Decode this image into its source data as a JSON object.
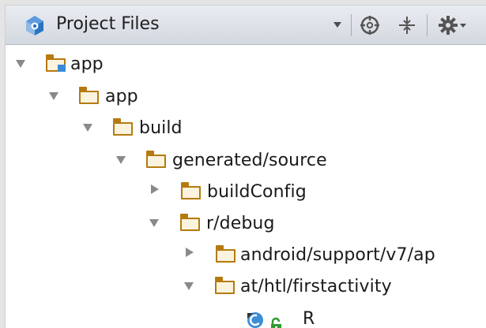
{
  "panel": {
    "view_title": "Project Files",
    "toolbar_icons": [
      "project-logo-icon",
      "chevron-down-icon",
      "scroll-from-source-icon",
      "collapse-all-icon",
      "gear-icon",
      "chevron-down-icon"
    ]
  },
  "tree": [
    {
      "label": "app",
      "kind": "module-folder",
      "state": "expanded"
    },
    {
      "label": "app",
      "kind": "folder",
      "state": "expanded"
    },
    {
      "label": "build",
      "kind": "folder",
      "state": "expanded"
    },
    {
      "label": "generated/source",
      "kind": "folder",
      "state": "expanded"
    },
    {
      "label": "buildConfig",
      "kind": "folder",
      "state": "collapsed"
    },
    {
      "label": "r/debug",
      "kind": "folder",
      "state": "expanded"
    },
    {
      "label": "android/support/v7/ap",
      "kind": "folder",
      "state": "collapsed"
    },
    {
      "label": "at/htl/firstactivity",
      "kind": "folder",
      "state": "expanded"
    },
    {
      "label": "R",
      "kind": "class",
      "state": "leaf",
      "icons": [
        "class-icon",
        "lock-icon"
      ]
    }
  ],
  "colors": {
    "folder": "#b57a0f",
    "module_badge": "#3a8ad8",
    "class_icon": "#3d8dd6",
    "lock_icon": "#2f9a2f"
  }
}
